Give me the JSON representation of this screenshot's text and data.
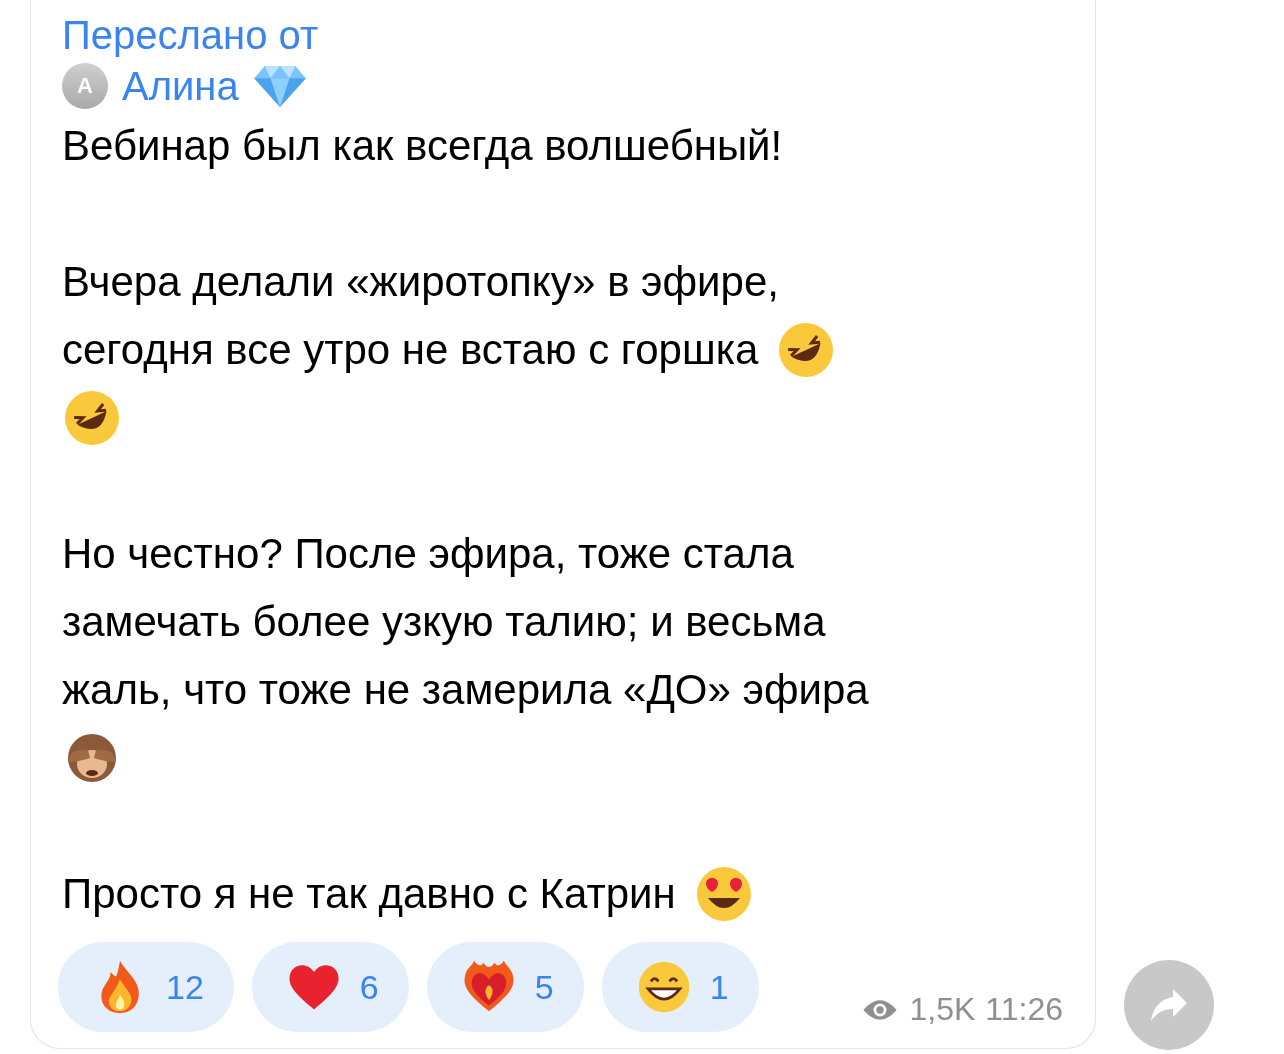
{
  "message": {
    "forwarded_label": "Переслано от",
    "sender": {
      "initial": "A",
      "name": "Алина"
    },
    "paragraphs": [
      {
        "lines": [
          "Вебинар был как всегда волшебный!"
        ]
      },
      {
        "lines": [
          "Вчера делали «жиротопку» в эфире,",
          "сегодня все утро не встаю с горшка"
        ]
      },
      {
        "lines": [
          "Но честно? После эфира, тоже стала",
          "замечать более узкую талию; и весьма",
          "жаль, что тоже не замерила «ДО» эфира"
        ]
      },
      {
        "lines": [
          "Просто я не так давно с Катрин"
        ]
      }
    ],
    "reactions": [
      {
        "count": "12",
        "selected": false
      },
      {
        "count": "6",
        "selected": false
      },
      {
        "count": "5",
        "selected": false
      },
      {
        "count": "1",
        "selected": false
      }
    ],
    "views": "1,5K",
    "time": "11:26"
  }
}
